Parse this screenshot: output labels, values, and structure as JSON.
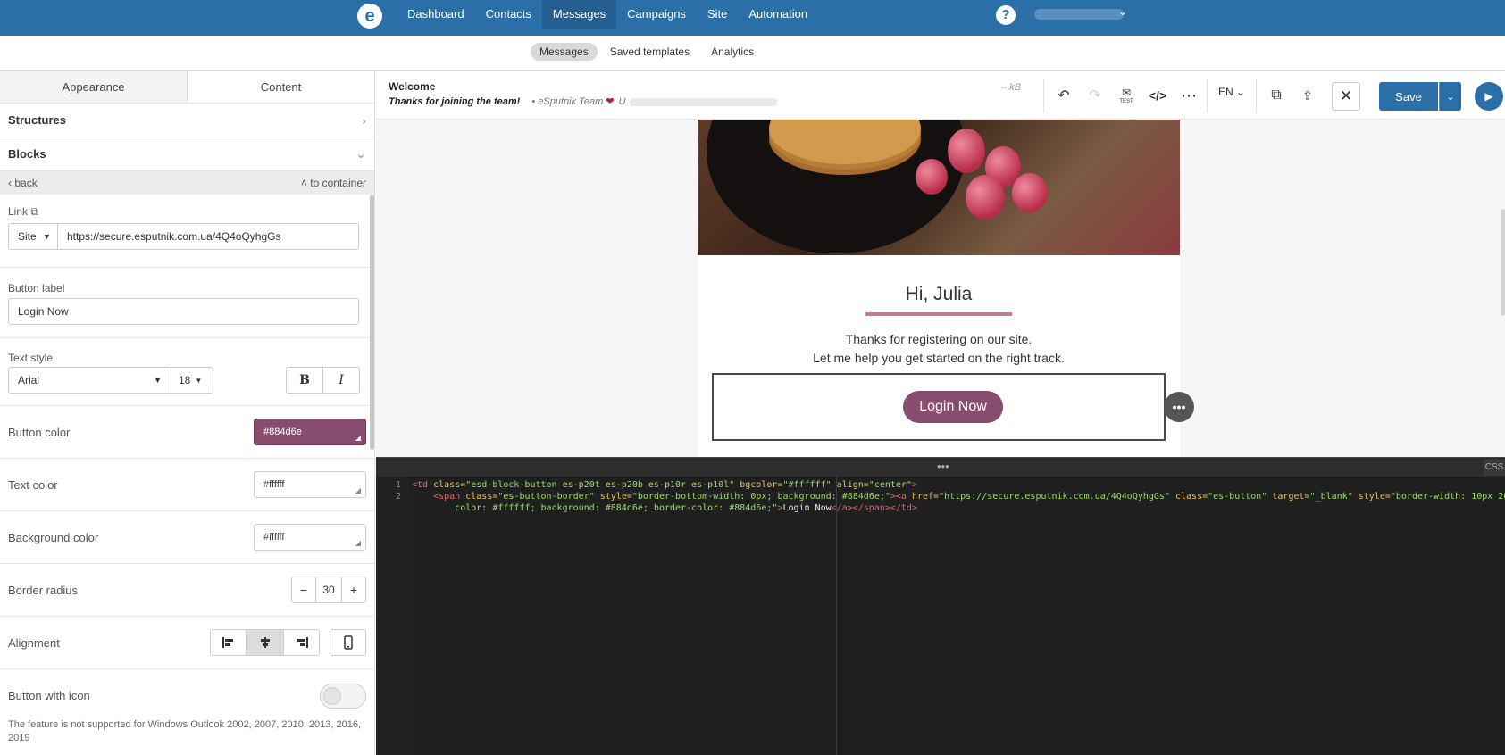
{
  "topnav": {
    "logo": "e",
    "items": [
      "Dashboard",
      "Contacts",
      "Messages",
      "Campaigns",
      "Site",
      "Automation"
    ],
    "active_index": 2,
    "help": "?"
  },
  "subnav": {
    "items": [
      "Messages",
      "Saved templates",
      "Analytics"
    ],
    "active_index": 0
  },
  "leftpanel": {
    "tabs": [
      "Appearance",
      "Content"
    ],
    "active_tab": "Content",
    "sections": {
      "structures": "Structures",
      "blocks": "Blocks"
    },
    "back": "back",
    "to_container": "to container",
    "link": {
      "label": "Link",
      "type": "Site",
      "url": "https://secure.esputnik.com.ua/4Q4oQyhgGs"
    },
    "button_label": {
      "label": "Button label",
      "value": "Login Now"
    },
    "text_style": {
      "label": "Text style",
      "font": "Arial",
      "size": "18",
      "bold": "B",
      "italic": "I"
    },
    "button_color": {
      "label": "Button color",
      "value": "#884d6e"
    },
    "text_color": {
      "label": "Text color",
      "value": "#ffffff"
    },
    "background_color": {
      "label": "Background color",
      "value": "#ffffff"
    },
    "border_radius": {
      "label": "Border radius",
      "value": "30",
      "minus": "−",
      "plus": "+"
    },
    "alignment": {
      "label": "Alignment"
    },
    "button_with_icon": {
      "label": "Button with icon"
    },
    "note": "The feature is not supported for Windows Outlook 2002, 2007, 2010, 2013, 2016, 2019"
  },
  "toolbar": {
    "subject": "Welcome",
    "preheader": "Thanks for joining the team!",
    "sender": "• eSputnik Team",
    "sender_suffix": "U",
    "size": "– kB",
    "lang": "EN",
    "save": "Save",
    "test_label": "TEST"
  },
  "email": {
    "greeting": "Hi, Julia",
    "line1": "Thanks for registering on our site.",
    "line2": "Let me help you get started on the right track.",
    "button": "Login Now",
    "button_color": "#884d6e"
  },
  "code": {
    "line_numbers": [
      "1",
      "2"
    ],
    "css_tab": "CSS"
  }
}
